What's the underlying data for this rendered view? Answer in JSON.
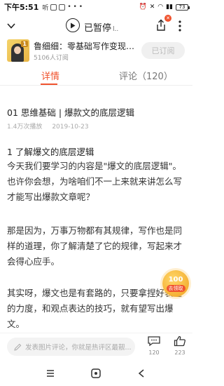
{
  "status_bar": {
    "time": "下午5:51",
    "left_extra": "听",
    "battery_level": "73"
  },
  "player": {
    "status": "已暂停",
    "bars": "l.."
  },
  "course": {
    "title": "鲁细细：零基础写作变现课...",
    "subscribers": "5106人订阅",
    "subscribe_label": "已订阅",
    "thumb_number": "1"
  },
  "tabs": {
    "detail": "详情",
    "comments": "评论（120）"
  },
  "episode": {
    "title": "01 思维基础 | 爆款文的底层逻辑",
    "plays": "1.4万次播放",
    "date": "2019-10-23"
  },
  "content": {
    "section_title": "1 了解爆文的底层逻辑",
    "paragraph1": "今天我们要学习的内容是\"爆文的底层逻辑\"。也许你会想，为啥咱们不一上来就来讲怎么写才能写出爆款文章呢？",
    "paragraph2": "那是因为，万事万物都有其规律，写作也是同样的道理，你了解清楚了它的规律，写起来才会得心应手。",
    "paragraph3": "其实呀，爆文也是有套路的，只要拿捏好表达的力度，和观点表达的技巧，就有望写出爆文。"
  },
  "reward": {
    "amount": "100",
    "label": "去领取"
  },
  "bottom_bar": {
    "comment_placeholder": "发表图片评论，你就是热评区最靓...",
    "comment_count": "120",
    "like_count": "223"
  },
  "colors": {
    "accent": "#f0532e",
    "reward": "#f0a11e"
  }
}
